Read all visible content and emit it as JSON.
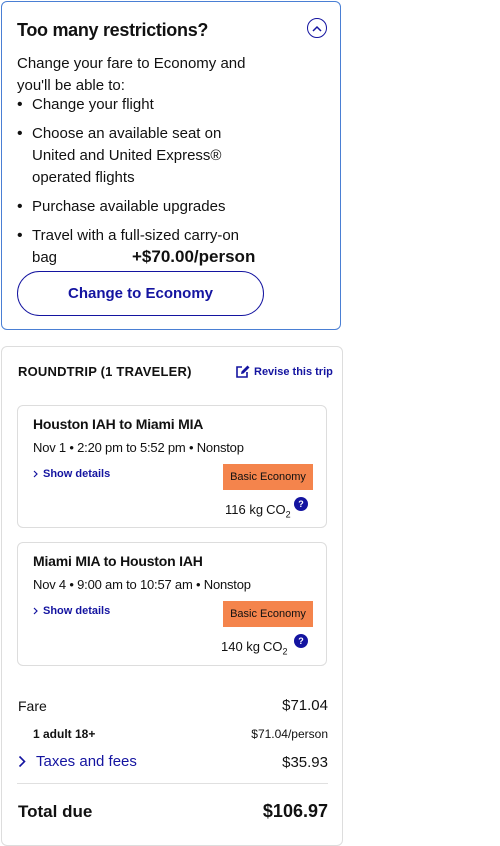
{
  "upsell": {
    "title": "Too many restrictions?",
    "intro": "Change your fare to Economy and you'll be able to:",
    "benefits": [
      "Change your flight",
      "Choose an available seat on United and United Express® operated flights",
      "Purchase available upgrades",
      "Travel with a full-sized carry-on bag"
    ],
    "price": "+$70.00/person",
    "button_label": "Change to Economy"
  },
  "summary": {
    "heading": "ROUNDTRIP (1 TRAVELER)",
    "revise_label": "Revise this trip",
    "flights": [
      {
        "route": "Houston IAH to Miami MIA",
        "times": "Nov 1 • 2:20 pm to 5:52 pm • Nonstop",
        "details_label": "Show details",
        "fare_badge": "Basic Economy",
        "co2_value": "116 kg",
        "co2_unit": "CO",
        "co2_sub": "2",
        "help_symbol": "?"
      },
      {
        "route": "Miami MIA to Houston IAH",
        "times": "Nov 4 • 9:00 am to 10:57 am • Nonstop",
        "details_label": "Show details",
        "fare_badge": "Basic Economy",
        "co2_value": "140 kg",
        "co2_unit": "CO",
        "co2_sub": "2",
        "help_symbol": "?"
      }
    ],
    "fare_label": "Fare",
    "fare_amount": "$71.04",
    "adult_label": "1 adult 18+",
    "adult_amount": "$71.04/person",
    "taxes_label": "Taxes and fees",
    "taxes_amount": "$35.93",
    "total_label": "Total due",
    "total_amount": "$106.97"
  },
  "colors": {
    "brand_blue": "#1414a0",
    "upsell_border": "#4a7fd4",
    "basic_economy_badge": "#f4844c"
  },
  "icons": {
    "collapse": "chevron-up-circle-icon",
    "revise": "edit-icon",
    "details": "chevron-right-icon",
    "help": "question-circle-icon"
  }
}
